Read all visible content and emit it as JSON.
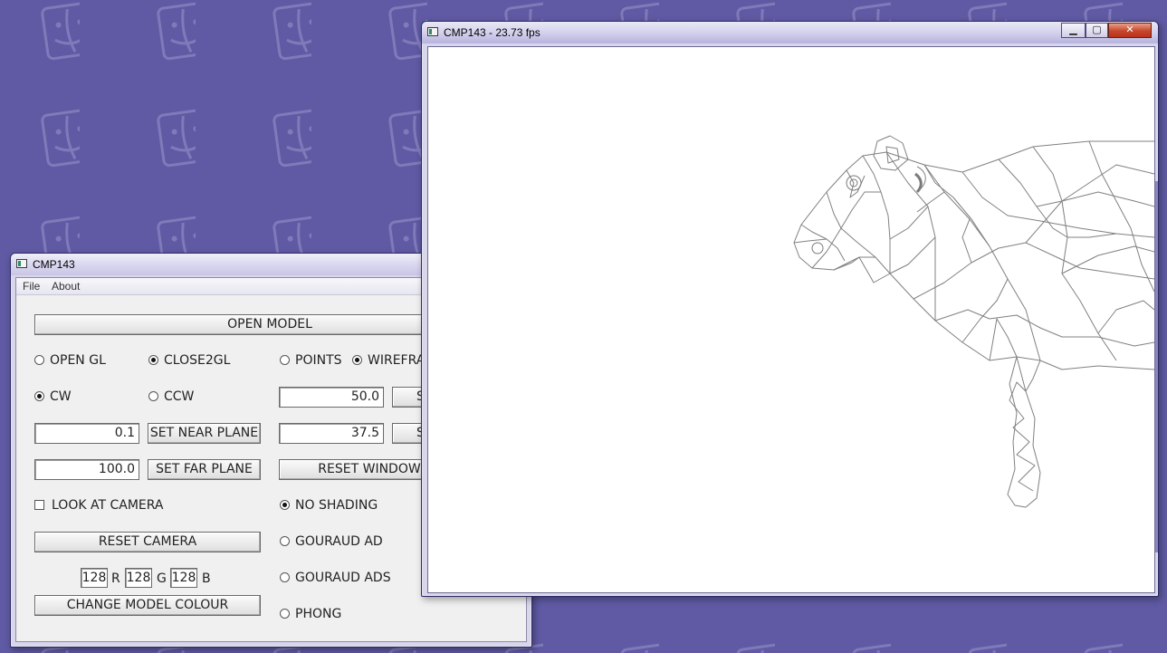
{
  "desktop": {
    "background_color": "#5f5aa3",
    "pattern_icon": "finder-face-icon"
  },
  "controls_window": {
    "title": "CMP143",
    "menu": [
      "File",
      "About"
    ],
    "open_model_button": "OPEN MODEL",
    "renderer_options": [
      {
        "label": "OPEN GL",
        "selected": false
      },
      {
        "label": "CLOSE2GL",
        "selected": true
      }
    ],
    "draw_mode_options": [
      {
        "label": "POINTS",
        "selected": false
      },
      {
        "label": "WIREFRA",
        "selected": true
      }
    ],
    "winding_options": [
      {
        "label": "CW",
        "selected": true
      },
      {
        "label": "CCW",
        "selected": false
      }
    ],
    "fov_h_value": "50.0",
    "fov_v_value": "37.5",
    "near_plane_value": "0.1",
    "set_near_plane_button": "SET NEAR PLANE",
    "far_plane_value": "100.0",
    "set_far_plane_button": "SET FAR PLANE",
    "reset_window_button": "RESET WINDOW",
    "set_button_truncated": "S",
    "look_at_camera_label": "LOOK AT CAMERA",
    "look_at_camera_checked": false,
    "reset_camera_button": "RESET CAMERA",
    "shading_options": [
      {
        "label": "NO SHADING",
        "selected": true
      },
      {
        "label": "GOURAUD AD",
        "selected": false
      },
      {
        "label": "GOURAUD ADS",
        "selected": false
      },
      {
        "label": "PHONG",
        "selected": false
      }
    ],
    "color": {
      "r": "128",
      "g": "128",
      "b": "128",
      "r_label": "R",
      "g_label": "G",
      "b_label": "B"
    },
    "change_model_colour_button": "CHANGE MODEL COLOUR"
  },
  "render_window": {
    "title": "CMP143 - 23.73 fps",
    "controls": {
      "minimize": "▁",
      "maximize": "▢",
      "close": "✕"
    },
    "model": "cow-wireframe",
    "wire_color": "#808080"
  }
}
